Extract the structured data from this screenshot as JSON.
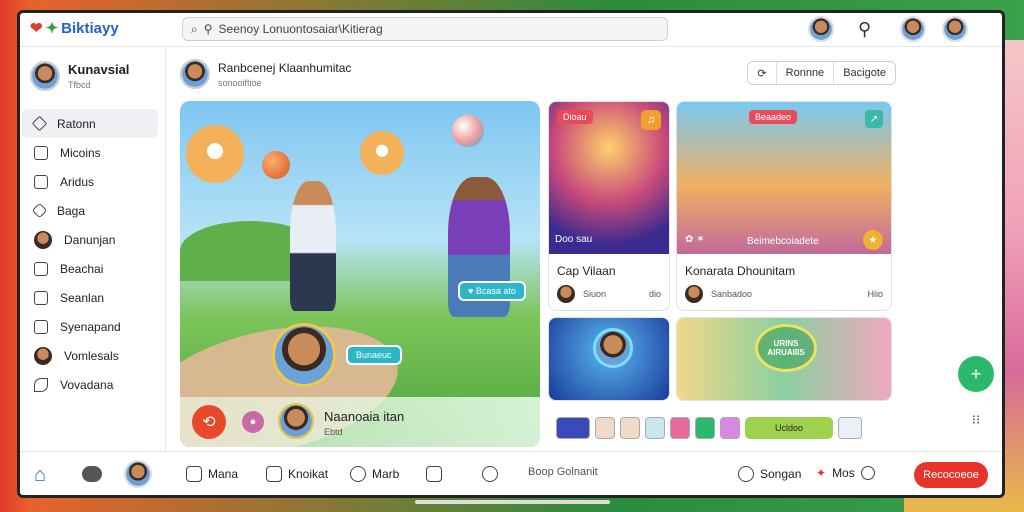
{
  "app": {
    "logo_text": "Biktiayy"
  },
  "search": {
    "text": "Seenoy Lonuontosaiar\\Kitierag"
  },
  "sidebar": {
    "profile": {
      "name": "Kunavsial",
      "sub": "Tfbcd"
    },
    "items": [
      {
        "label": "Ratonn",
        "icon": "home-icon"
      },
      {
        "label": "Micoins",
        "icon": "list-icon"
      },
      {
        "label": "Aridus",
        "icon": "square-icon"
      },
      {
        "label": "Baga",
        "icon": "tag-icon"
      },
      {
        "label": "Danunjan",
        "icon": "avatar-icon"
      },
      {
        "label": "Beachai",
        "icon": "chat-icon"
      },
      {
        "label": "Seanlan",
        "icon": "layers-icon"
      },
      {
        "label": "Syenapand",
        "icon": "grid-icon"
      },
      {
        "label": "Vomlesals",
        "icon": "avatar-icon"
      },
      {
        "label": "Vovadana",
        "icon": "leaf-icon"
      }
    ]
  },
  "channel": {
    "title": "Ranbcenej Klaanhumitac",
    "sub": "sonooiftioe"
  },
  "actions": {
    "a1": "Ronnne",
    "a2": "Bacigote"
  },
  "hero": {
    "tag1": "Bcasa ato",
    "tag2": "Bunaeuc",
    "bar_title": "Naanoaia itan",
    "bar_sub": "Ebtd"
  },
  "cards": [
    {
      "caption": "Cap Vilaan",
      "meta": "Siuon",
      "meta_right": "dio",
      "pill": "Dioau",
      "badge": "Doo sau"
    },
    {
      "caption": "Konarata Dhounitam",
      "meta": "Sanbadoo",
      "meta_right": "Hiio",
      "pill": "Beaadeo",
      "badge": "Beimebcoiadete"
    }
  ],
  "lower_cards": [
    {
      "label": ""
    },
    {
      "label": "URINS AIRUAIIIS"
    }
  ],
  "thumb_strip": {
    "wide_label": "Ucldoo"
  },
  "bottombar": {
    "items": [
      "Mana",
      "Knoikat",
      "Marb",
      ""
    ],
    "center_label": "Boop Golnanit",
    "right1": "Songan",
    "right2": "Mos",
    "subscribe": "Recocoeoe"
  }
}
